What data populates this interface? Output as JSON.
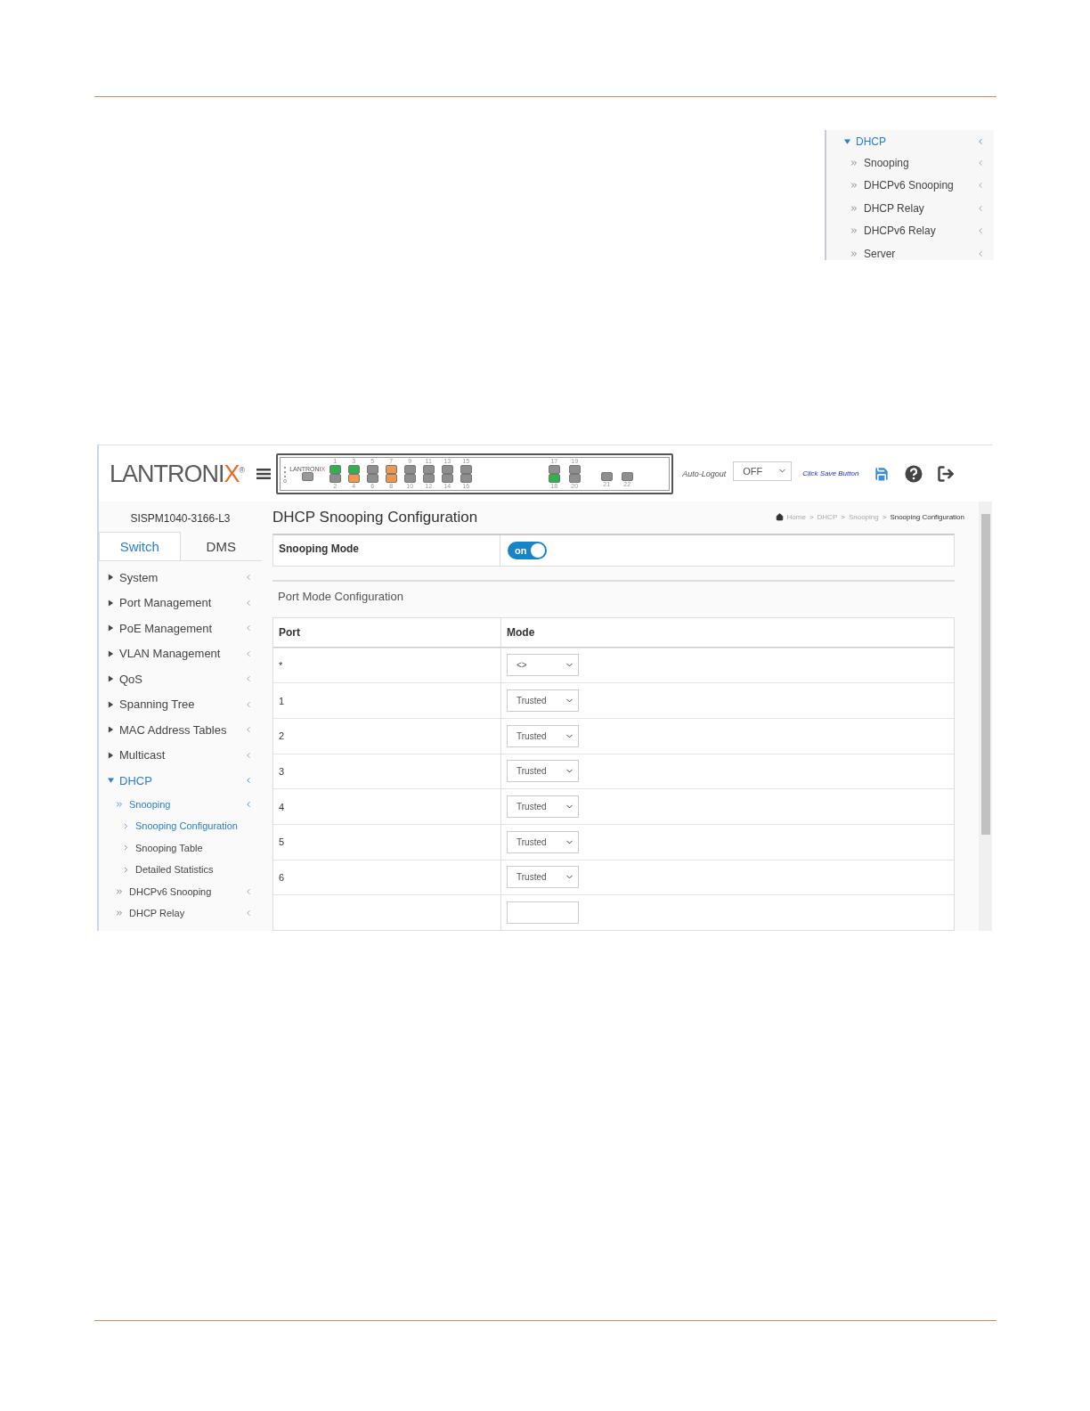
{
  "sidebar_excerpt": {
    "items": [
      {
        "label": "DHCP",
        "expanded": true,
        "children": [
          {
            "label": "Snooping",
            "expanded": false
          },
          {
            "label": "DHCPv6 Snooping",
            "expanded": false
          },
          {
            "label": "DHCP Relay",
            "expanded": false
          },
          {
            "label": "DHCPv6 Relay",
            "expanded": false
          },
          {
            "label": "Server",
            "expanded": false
          }
        ]
      }
    ]
  },
  "app": {
    "logo": {
      "name": "LANTRONI",
      "accent": "X",
      "registered": "®"
    },
    "faceplate": {
      "logo": {
        "name": "LANTRONI",
        "accent": "X"
      },
      "rj45_ports": [
        {
          "number": "1",
          "color": "#2fb24c"
        },
        {
          "number": "2",
          "color": "#8e8e8e"
        },
        {
          "number": "3",
          "color": "#2fb24c"
        },
        {
          "number": "4",
          "color": "#f0964f"
        },
        {
          "number": "5",
          "color": "#8e8e8e"
        },
        {
          "number": "6",
          "color": "#8e8e8e"
        },
        {
          "number": "7",
          "color": "#f0964f"
        },
        {
          "number": "8",
          "color": "#f0964f"
        },
        {
          "number": "9",
          "color": "#8e8e8e"
        },
        {
          "number": "10",
          "color": "#8e8e8e"
        },
        {
          "number": "11",
          "color": "#8e8e8e"
        },
        {
          "number": "12",
          "color": "#8e8e8e"
        },
        {
          "number": "13",
          "color": "#8e8e8e"
        },
        {
          "number": "14",
          "color": "#8e8e8e"
        },
        {
          "number": "15",
          "color": "#8e8e8e"
        },
        {
          "number": "16",
          "color": "#8e8e8e"
        }
      ],
      "sfp_ports": [
        {
          "number": "17",
          "color": "#8e8e8e"
        },
        {
          "number": "18",
          "color": "#2fb24c"
        },
        {
          "number": "19",
          "color": "#8e8e8e"
        },
        {
          "number": "20",
          "color": "#8e8e8e"
        }
      ],
      "uplink_ports": [
        {
          "number": "21",
          "color": "#8e8e8e"
        },
        {
          "number": "22",
          "color": "#8e8e8e"
        }
      ]
    },
    "auto_logout": {
      "label": "Auto-Logout",
      "value": "OFF"
    },
    "save_hint": "Click Save Button",
    "device_name": "SISPM1040-3166-L3",
    "tabs": [
      {
        "label": "Switch",
        "selected": true
      },
      {
        "label": "DMS",
        "selected": false
      }
    ],
    "sidebar": [
      {
        "label": "System",
        "expanded": false
      },
      {
        "label": "Port Management",
        "expanded": false
      },
      {
        "label": "PoE Management",
        "expanded": false
      },
      {
        "label": "VLAN Management",
        "expanded": false
      },
      {
        "label": "QoS",
        "expanded": false
      },
      {
        "label": "Spanning Tree",
        "expanded": false
      },
      {
        "label": "MAC Address Tables",
        "expanded": false
      },
      {
        "label": "Multicast",
        "expanded": false
      },
      {
        "label": "DHCP",
        "expanded": true,
        "children": [
          {
            "label": "Snooping",
            "expanded": true,
            "children": [
              {
                "label": "Snooping Configuration",
                "selected": true
              },
              {
                "label": "Snooping Table",
                "selected": false
              },
              {
                "label": "Detailed Statistics",
                "selected": false
              }
            ]
          },
          {
            "label": "DHCPv6 Snooping",
            "expanded": false
          },
          {
            "label": "DHCP Relay",
            "expanded": false
          }
        ]
      }
    ],
    "page_title": "DHCP Snooping Configuration",
    "breadcrumb": {
      "separator": ">",
      "items": [
        "Home",
        "DHCP",
        "Snooping",
        "Snooping Configuration"
      ]
    },
    "snooping_mode": {
      "label": "Snooping Mode",
      "toggle_text": "on",
      "on": true
    },
    "port_mode": {
      "title": "Port Mode Configuration",
      "columns": [
        "Port",
        "Mode"
      ],
      "rows": [
        {
          "port": "*",
          "mode": "<>"
        },
        {
          "port": "1",
          "mode": "Trusted"
        },
        {
          "port": "2",
          "mode": "Trusted"
        },
        {
          "port": "3",
          "mode": "Trusted"
        },
        {
          "port": "4",
          "mode": "Trusted"
        },
        {
          "port": "5",
          "mode": "Trusted"
        },
        {
          "port": "6",
          "mode": "Trusted"
        }
      ]
    }
  }
}
